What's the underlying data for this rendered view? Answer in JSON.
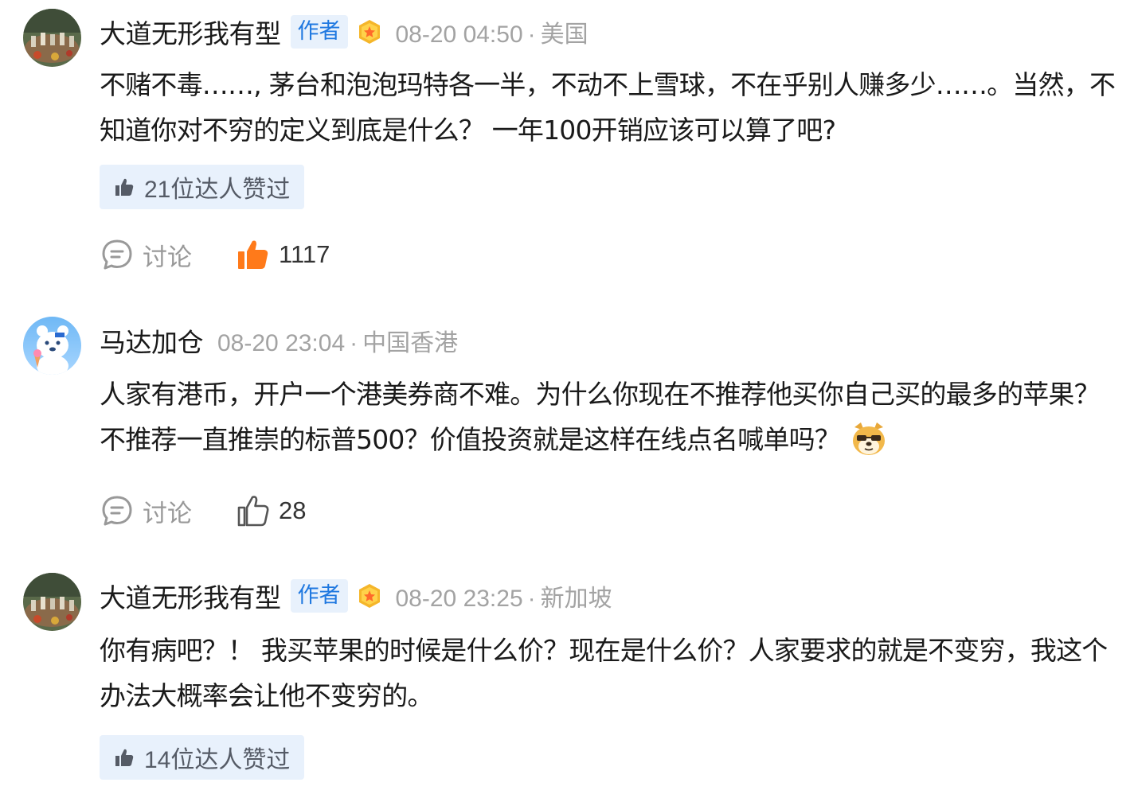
{
  "comments": [
    {
      "username": "大道无形我有型",
      "author_badge": "作者",
      "time": "08-20 04:50",
      "separator": "·",
      "location": "美国",
      "text": "不赌不毒……, 茅台和泡泡玛特各一半，不动不上雪球，不在乎别人赚多少……。当然，不知道你对不穷的定义到底是什么？ 一年100开销应该可以算了吧?",
      "expert_likes": "21位达人赞过",
      "discuss_label": "讨论",
      "like_count": "1117",
      "liked": true
    },
    {
      "username": "马达加仓",
      "time": "08-20 23:04",
      "separator": "·",
      "location": "中国香港",
      "text": "人家有港币，开户一个港美券商不难。为什么你现在不推荐他买你自己买的最多的苹果？不推荐一直推崇的标普500？价值投资就是这样在线点名喊单吗？",
      "discuss_label": "讨论",
      "like_count": "28",
      "liked": false
    },
    {
      "username": "大道无形我有型",
      "author_badge": "作者",
      "time": "08-20 23:25",
      "separator": "·",
      "location": "新加坡",
      "text": "你有病吧？！ 我买苹果的时候是什么价？现在是什么价？人家要求的就是不变穷，我这个办法大概率会让他不变穷的。",
      "expert_likes": "14位达人赞过"
    }
  ],
  "colors": {
    "accent_blue": "#1f78e0",
    "badge_bg": "#e8f1fc",
    "liked_orange": "#ff7a1a",
    "meta_gray": "#a3a3a3"
  },
  "icons": {
    "discuss": "speech-bubble-icon",
    "like": "thumbs-up-icon",
    "medal": "medal-icon",
    "emoji": "doge-emoji-icon"
  }
}
